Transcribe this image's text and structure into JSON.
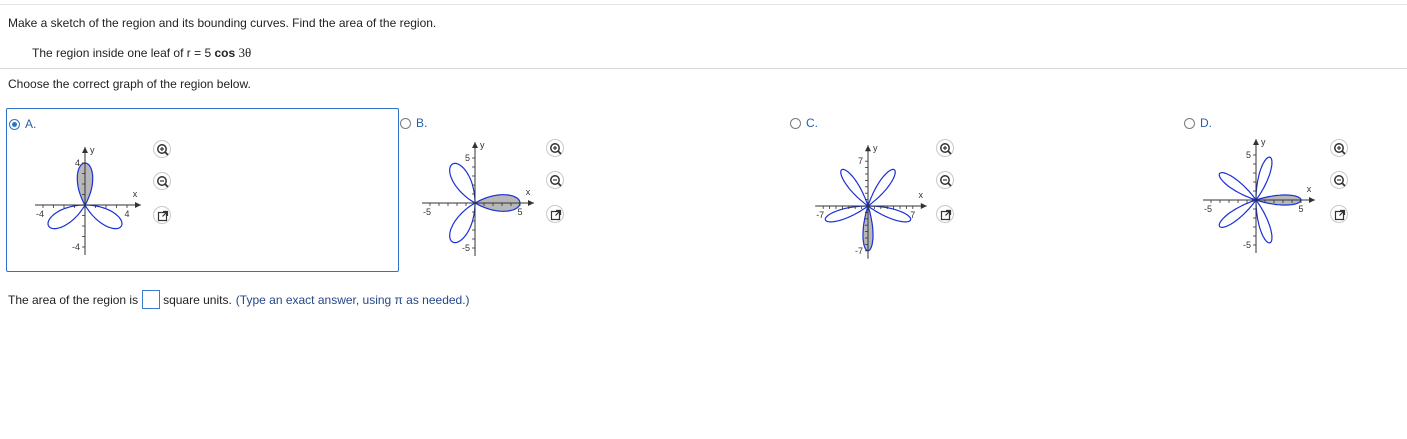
{
  "question": {
    "instruction": "Make a sketch of the region and its bounding curves. Find the area of the region.",
    "region_text": "The region inside one leaf of r = 5",
    "region_func": "cos",
    "region_arg": "3θ"
  },
  "prompt": "Choose the correct graph of the region below.",
  "options": [
    {
      "letter": "A.",
      "selected": true,
      "axis_label_x": "x",
      "axis_label_y": "y",
      "tick_pos_x": "4",
      "tick_neg_x": "-4",
      "tick_pos_y": "4",
      "tick_neg_y": "-4"
    },
    {
      "letter": "B.",
      "selected": false,
      "axis_label_x": "x",
      "axis_label_y": "y",
      "tick_pos_x": "5",
      "tick_neg_x": "-5",
      "tick_pos_y": "5",
      "tick_neg_y": "-5"
    },
    {
      "letter": "C.",
      "selected": false,
      "axis_label_x": "x",
      "axis_label_y": "y",
      "tick_pos_x": "7",
      "tick_neg_x": "-7",
      "tick_pos_y": "7",
      "tick_neg_y": "-7"
    },
    {
      "letter": "D.",
      "selected": false,
      "axis_label_x": "x",
      "axis_label_y": "y",
      "tick_pos_x": "5",
      "tick_neg_x": "-5",
      "tick_pos_y": "5",
      "tick_neg_y": "-5"
    }
  ],
  "tools": {
    "zoom_in": "zoom-in-icon",
    "zoom_out": "zoom-out-icon",
    "open_window": "external-window-icon"
  },
  "answer": {
    "prefix": "The area of the region is",
    "suffix": "square units.",
    "hint": "(Type an exact answer, using π as needed.)"
  },
  "colors": {
    "accent": "#2f73c8",
    "curve": "#1a2fd6",
    "shade": "#b8b8b8"
  }
}
